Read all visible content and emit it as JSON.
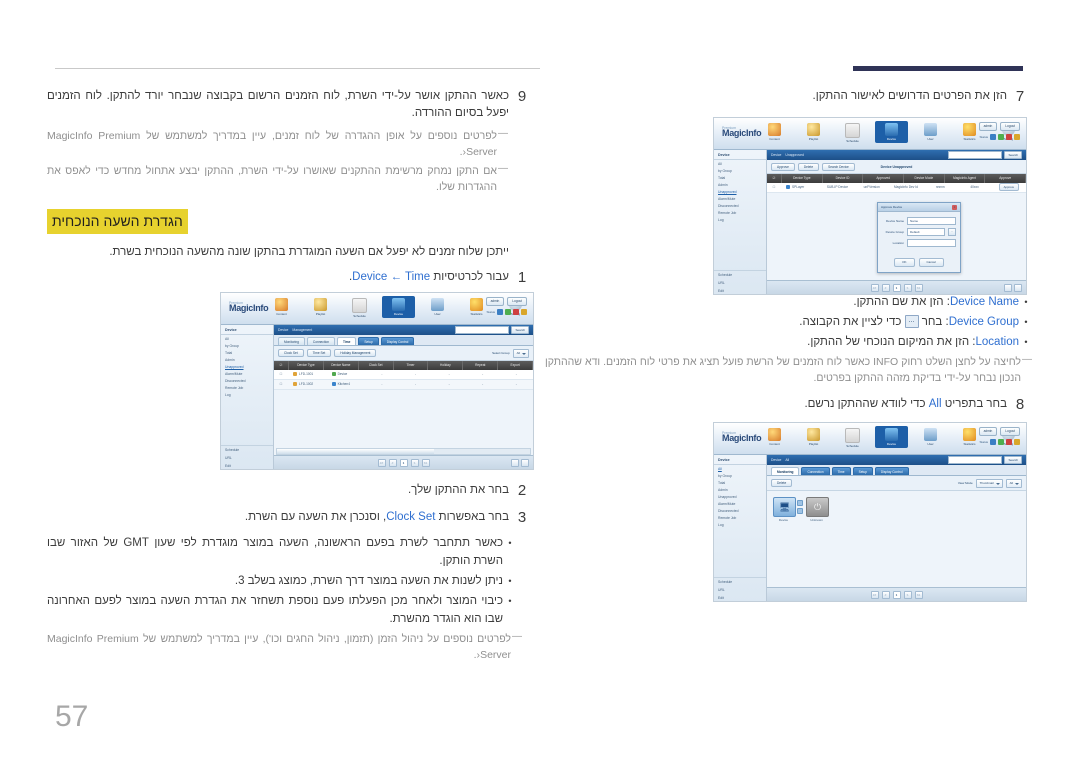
{
  "page": {
    "number": "57",
    "language": "he"
  },
  "left_column": {
    "step9": {
      "num": "9",
      "text": "כאשר ההתקן אושר על-ידי השרת, לוח הזמנים הרשום בקבוצה שנבחר יורד להתקן. לוח הזמנים יפעל בסיום ההורדה."
    },
    "note_a": {
      "dash": "―",
      "text_before": "לפרטים נוספים על אופן ההגדרה של לוח זמנים, עיין ב",
      "link": "מדריך למשתמש של MagicInfo Premium Server",
      "text_after": "‹."
    },
    "note_b": {
      "dash": "―",
      "text": "אם התקן נמחק מרשימת ההתקנים שאושרו על-ידי השרת, ההתקן יבצע אתחול מחדש כדי לאפס את ההגדרות שלו."
    },
    "section_heading": "הגדרת השעה הנוכחית",
    "intro": "ייתכן שלוח זמנים לא יפעל אם השעה המוגדרת בהתקן שונה מהשעה הנוכחית בשרת.",
    "step1": {
      "num": "1",
      "text_before": "עבור לכרטיסיות ",
      "ui": "Device ← Time",
      "text_after": "."
    },
    "step2": {
      "num": "2",
      "text": "בחר את ההתקן שלך."
    },
    "step3": {
      "num": "3",
      "text_before": "בחר באפשרות ",
      "ui": "Clock Set",
      "text_after": ", וסנכרן את השעה עם השרת."
    },
    "bullets": [
      "כאשר תתחבר לשרת בפעם הראשונה, השעה במוצר מוגדרת לפי שעון GMT של האזור שבו השרת הותקן.",
      "ניתן לשנות את השעה במוצר דרך השרת, כמוצג בשלב 3.",
      "כיבוי המוצר ולאחר מכן הפעלתו פעם נוספת תשחזר את הגדרת השעה במוצר לפעם האחרונה שבו הוא הוגדר מהשרת."
    ],
    "note_c": {
      "dash": "―",
      "text_before": "לפרטים נוספים על ניהול הזמן (תזמון, ניהול החגים וכו'), עיין ב",
      "link": "מדריך למשתמש של MagicInfo Premium Server",
      "text_after": "‹."
    }
  },
  "right_column": {
    "step7": {
      "num": "7",
      "text": "הזן את הפרטים הדרושים לאישור ההתקן."
    },
    "field_bullets": [
      {
        "dot": "•",
        "label": "Device Name",
        "text": ": הזן את שם ההתקן."
      },
      {
        "dot": "•",
        "label": "Device Group",
        "text_before": ": בחר ",
        "button": "...",
        "text_after": " כדי לציין את הקבוצה."
      },
      {
        "dot": "•",
        "label": "Location",
        "text": ": הזן את המיקום הנוכחי של ההתקן."
      }
    ],
    "note_info": {
      "dash": "―",
      "text": "לחיצה על לחצן השלט רחוק INFO כאשר לוח הזמנים של הרשת פועל תציג את פרטי לוח הזמנים. ודא שההתקן הנכון נבחר על-ידי בדיקת מזהה ההתקן בפרטים."
    },
    "step8": {
      "num": "8",
      "text_before": "בחר בתפריט ",
      "ui": "All",
      "text_after": " כדי לוודא שההתקן נרשם."
    }
  },
  "app_screenshot": {
    "brand": "MagicInfo",
    "brand_sub": "Premium",
    "nav": [
      {
        "label": "Content",
        "icon": "content-icon"
      },
      {
        "label": "Playlist",
        "icon": "playlist-icon"
      },
      {
        "label": "Schedule",
        "icon": "schedule-icon"
      },
      {
        "label": "Device",
        "icon": "device-icon",
        "active": true
      },
      {
        "label": "User",
        "icon": "user-icon"
      },
      {
        "label": "Statistics",
        "icon": "statistics-icon"
      },
      {
        "label": "Setting",
        "icon": "setting-icon"
      }
    ],
    "account": {
      "user_btn": "admin",
      "logout_btn": "Logout",
      "status_label": "Status"
    },
    "sidebar": {
      "head": "Device",
      "items": [
        "All",
        "by Group",
        "Total",
        "Admin",
        "Unapproved",
        "Alarm/Mute",
        "Disconnected",
        "Remote Job",
        "Log"
      ],
      "footer_items": [
        "Schedule",
        "URL",
        "Edit"
      ]
    },
    "breadcrumb": [
      "Device",
      "Management"
    ],
    "search": {
      "placeholder": "",
      "button": "Search"
    },
    "tabs": [
      "Monitoring",
      "Connection",
      "Time",
      "Setup",
      "Display Control"
    ],
    "toolbar": {
      "buttons": [
        "Clock Set",
        "Time Set",
        "Holiday Management"
      ],
      "select_label": "Select Group",
      "select_value": "All"
    },
    "table": {
      "headers": [
        "Device Type",
        "Device Name",
        "Clock Set",
        "Timer",
        "Holiday",
        "Repeat",
        "Export"
      ],
      "rows": [
        {
          "type": "LFD-1001",
          "name": "Device",
          "values": [
            "-",
            "-",
            "-",
            "-",
            "-"
          ]
        },
        {
          "type": "LFD-1002",
          "name": "Kitchen4",
          "values": [
            "-",
            "-",
            "-",
            "-",
            "-"
          ]
        }
      ]
    },
    "footer": {
      "pages": [
        "<<",
        "<",
        "1",
        ">",
        ">>"
      ],
      "current": "1"
    }
  },
  "approve_screenshot": {
    "breadcrumb": [
      "Device",
      "Unapproved"
    ],
    "toolbar_buttons": [
      "Approve",
      "Delete",
      "Search Device"
    ],
    "header_title": "Device Unapproved",
    "table": {
      "headers": [
        "Device Type",
        "Device ID",
        "Approved",
        "Device Mode",
        "MagicInfo Agent",
        "Approve"
      ],
      "row": {
        "type": "SPLayer",
        "id": "SUB-IP Device",
        "approved": "unFVersion",
        "mode": "MagicInfo Dev Id",
        "agent": "nnnnn",
        "version": "40xxx",
        "action": "Approve"
      }
    },
    "modal": {
      "title": "Approve Device",
      "fields": [
        {
          "label": "Device Name",
          "value": "Name"
        },
        {
          "label": "Device Group",
          "value": "Default",
          "has_picker": true,
          "picker": "..."
        },
        {
          "label": "Location",
          "value": ""
        }
      ],
      "ok": "OK",
      "cancel": "Cancel"
    }
  },
  "all_devices_screenshot": {
    "breadcrumb": [
      "Device",
      "All"
    ],
    "tabs": [
      "Monitoring",
      "Connection",
      "Time",
      "Setup",
      "Display Control"
    ],
    "toolbar": {
      "button": "Delete",
      "select_label": "View Mode",
      "select_value": "Thumbnail",
      "filter_value": "All"
    },
    "devices": [
      {
        "name": "Device",
        "state": "on",
        "icon": "monitor-icon"
      },
      {
        "name": "Unknown",
        "state": "off",
        "icon": "power-icon"
      }
    ],
    "sidebar_items": [
      "All",
      "by Group",
      "Total",
      "Admin",
      "Unapproved",
      "Alarm/Mute",
      "Disconnected",
      "Remote Job",
      "Log"
    ],
    "footer_items": [
      "Schedule",
      "URL",
      "Edit"
    ]
  },
  "colors": {
    "accent_blue": "#2f6fd0",
    "rule_navy": "#2f3357",
    "highlight_yellow": "#e7d22e",
    "body_text": "#3c3c3c",
    "note_text": "#8f8f8f",
    "page_number": "#a7a7a7"
  }
}
